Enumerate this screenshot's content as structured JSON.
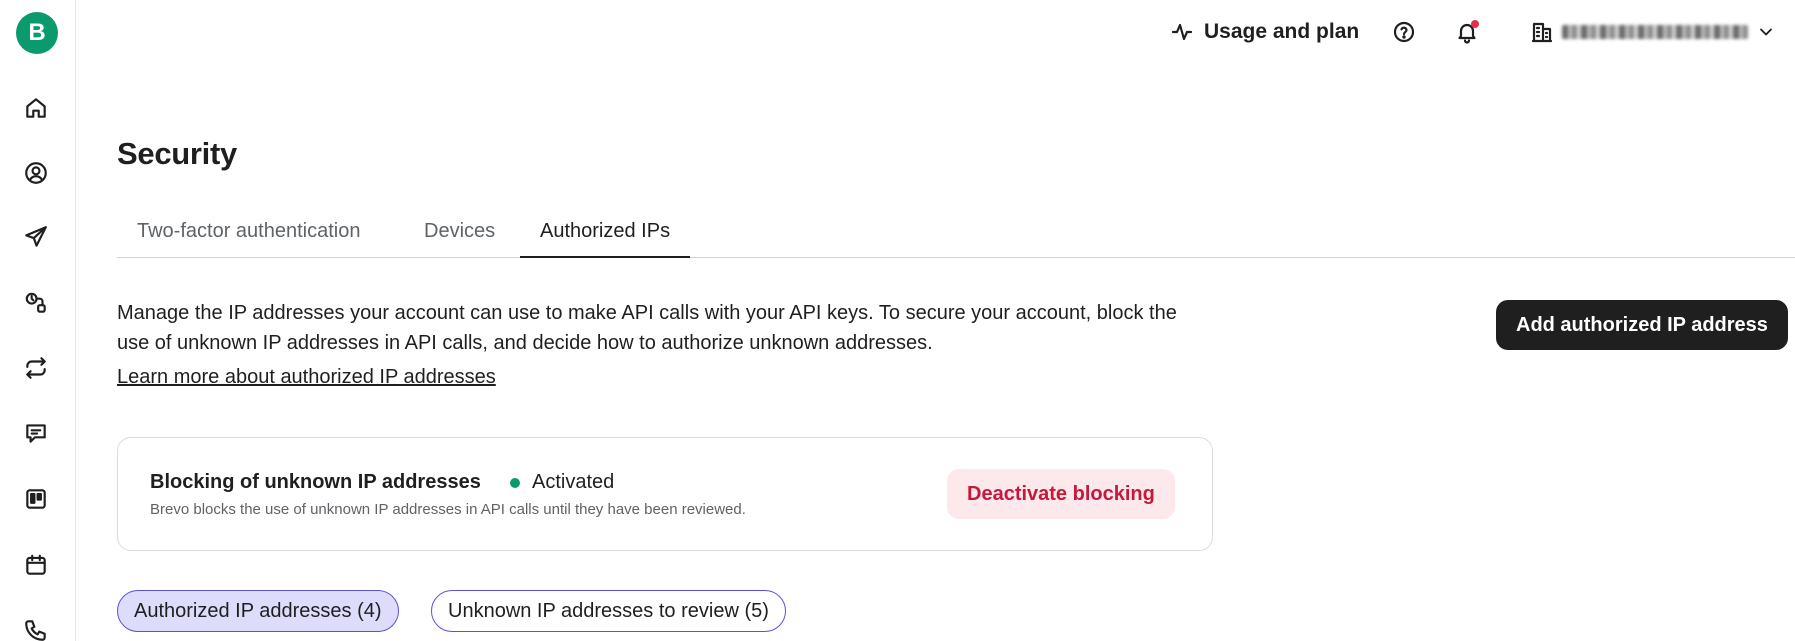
{
  "brand": {
    "logo_letter": "B",
    "accent_color": "#0b996e"
  },
  "sidebar": {
    "items": [
      {
        "icon": "home-icon"
      },
      {
        "icon": "contacts-icon"
      },
      {
        "icon": "campaigns-send-icon"
      },
      {
        "icon": "automations-icon"
      },
      {
        "icon": "transactional-icon"
      },
      {
        "icon": "conversations-icon"
      },
      {
        "icon": "deals-board-icon"
      },
      {
        "icon": "meetings-calendar-icon"
      },
      {
        "icon": "phone-icon"
      }
    ]
  },
  "topbar": {
    "usage_label": "Usage and plan",
    "help_icon": "help-icon",
    "notifications_icon": "bell-icon",
    "notification_dot_color": "#e0304f",
    "org_icon": "building-icon"
  },
  "page": {
    "title": "Security",
    "tabs": [
      {
        "label": "Two-factor authentication",
        "active": false
      },
      {
        "label": "Devices",
        "active": false
      },
      {
        "label": "Authorized IPs",
        "active": true
      }
    ],
    "description": "Manage the IP addresses your account can use to make API calls with your API keys. To secure your account, block the use of unknown IP addresses in API calls, and decide how to authorize unknown addresses.",
    "learn_more": "Learn more about authorized IP addresses",
    "add_button": "Add authorized IP address"
  },
  "blocking_card": {
    "title": "Blocking of unknown IP addresses",
    "status": "Activated",
    "status_color": "#0b996e",
    "subtitle": "Brevo blocks the use of unknown IP addresses in API calls until they have been reviewed.",
    "deactivate_button": "Deactivate blocking"
  },
  "filters": [
    {
      "label": "Authorized IP addresses (4)",
      "selected": true
    },
    {
      "label": "Unknown IP addresses to review (5)",
      "selected": false
    }
  ]
}
